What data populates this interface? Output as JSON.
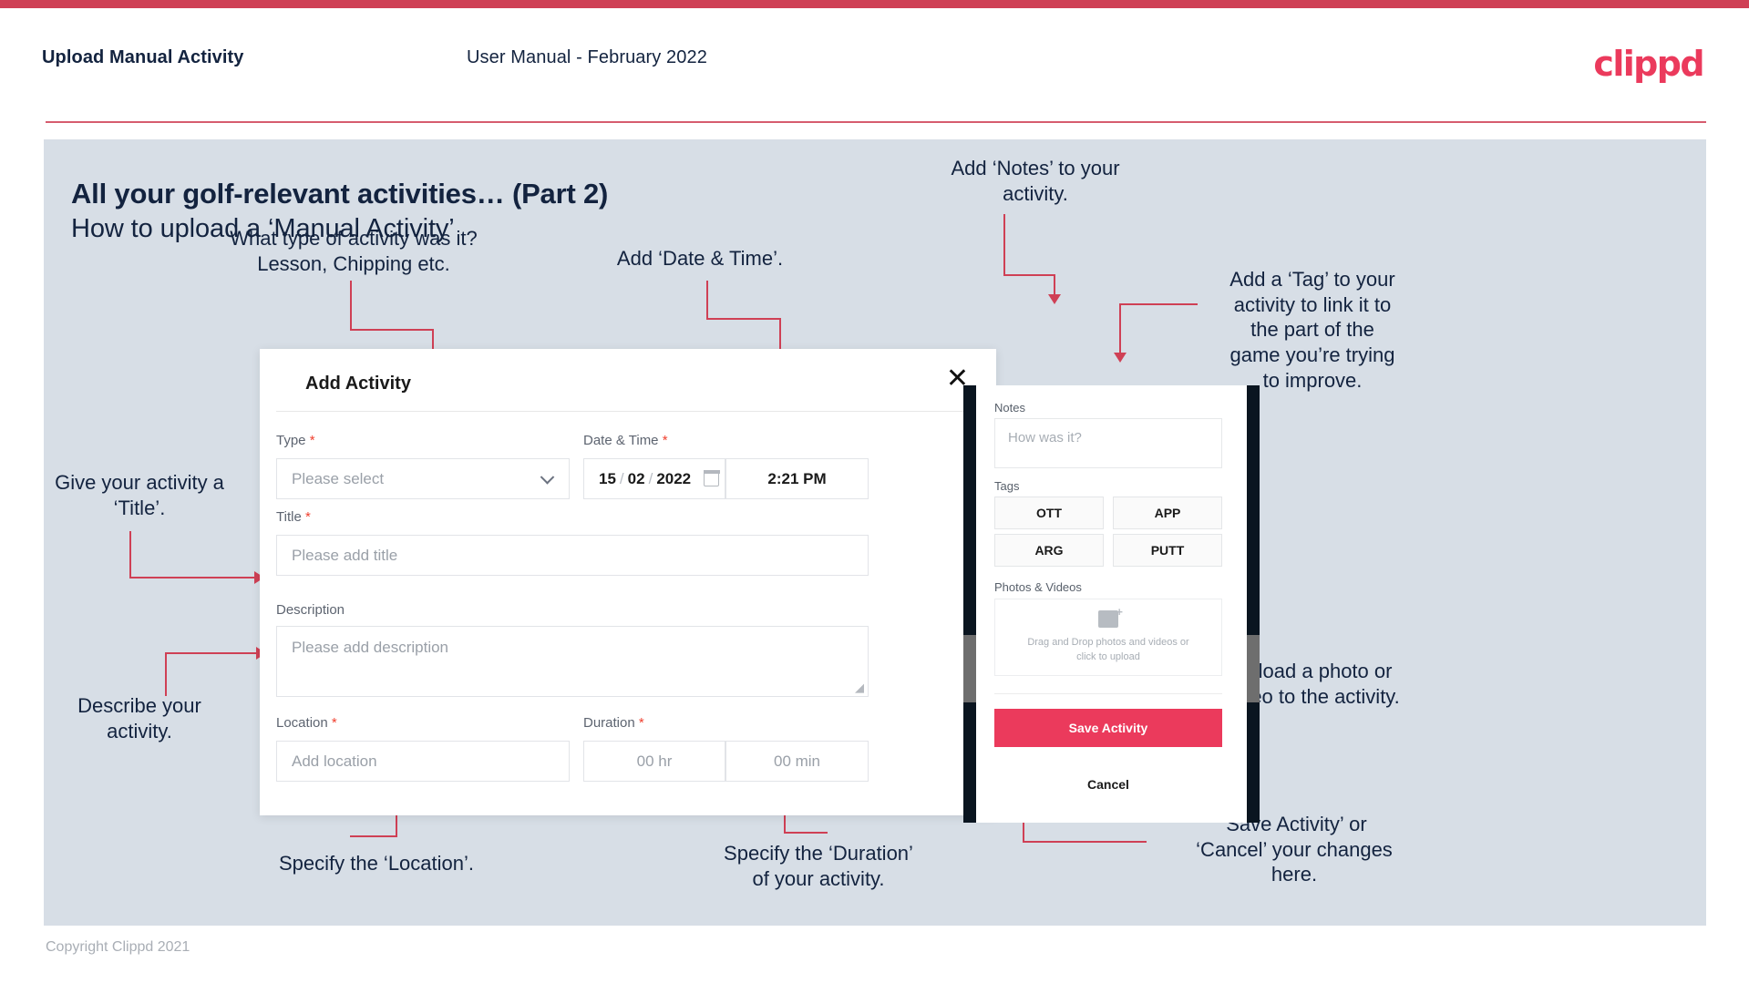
{
  "brand": {
    "logo_text": "clippd",
    "accent": "#eb3a5c",
    "rule_color": "#cf4055"
  },
  "header": {
    "title": "Upload Manual Activity",
    "subtitle": "User Manual - February 2022"
  },
  "slide": {
    "title": "All your golf-relevant activities… (Part 2)",
    "subtitle": "How to upload a ‘Manual Activity’"
  },
  "annotations": {
    "type": "What type of activity was it?\nLesson, Chipping etc.",
    "datetime": "Add ‘Date & Time’.",
    "title": "Give your activity a\n‘Title’.",
    "description": "Describe your\nactivity.",
    "location": "Specify the ‘Location’.",
    "duration": "Specify the ‘Duration’\nof your activity.",
    "notes": "Add ‘Notes’ to your\nactivity.",
    "tags": "Add a ‘Tag’ to your\nactivity to link it to\nthe part of the\ngame you’re trying\nto improve.",
    "upload": "Upload a photo or\nvideo to the activity.",
    "save_cancel": "‘Save Activity’ or\n‘Cancel’ your changes\nhere."
  },
  "dialog": {
    "title": "Add Activity",
    "close_icon": "close-icon",
    "fields": {
      "type": {
        "label": "Type",
        "required": "*",
        "placeholder": "Please select"
      },
      "datetime": {
        "label": "Date & Time",
        "required": "*",
        "day": "15",
        "sep1": "/",
        "month": "02",
        "sep2": "/",
        "year": "2022",
        "calendar_icon": "calendar-icon",
        "time": "2:21 PM"
      },
      "title": {
        "label": "Title",
        "required": "*",
        "placeholder": "Please add title"
      },
      "description": {
        "label": "Description",
        "placeholder": "Please add description"
      },
      "location": {
        "label": "Location",
        "required": "*",
        "placeholder": "Add location"
      },
      "duration": {
        "label": "Duration",
        "required": "*",
        "hours": "00 hr",
        "minutes": "00 min"
      }
    }
  },
  "phone": {
    "notes": {
      "label": "Notes",
      "placeholder": "How was it?"
    },
    "tags": {
      "label": "Tags",
      "items": [
        "OTT",
        "APP",
        "ARG",
        "PUTT"
      ]
    },
    "photos": {
      "label": "Photos & Videos",
      "drop_text": "Drag and Drop photos and videos or\nclick to upload",
      "icon": "image-add-icon"
    },
    "save_label": "Save Activity",
    "cancel_label": "Cancel"
  },
  "footer": {
    "copyright": "Copyright Clippd 2021"
  }
}
